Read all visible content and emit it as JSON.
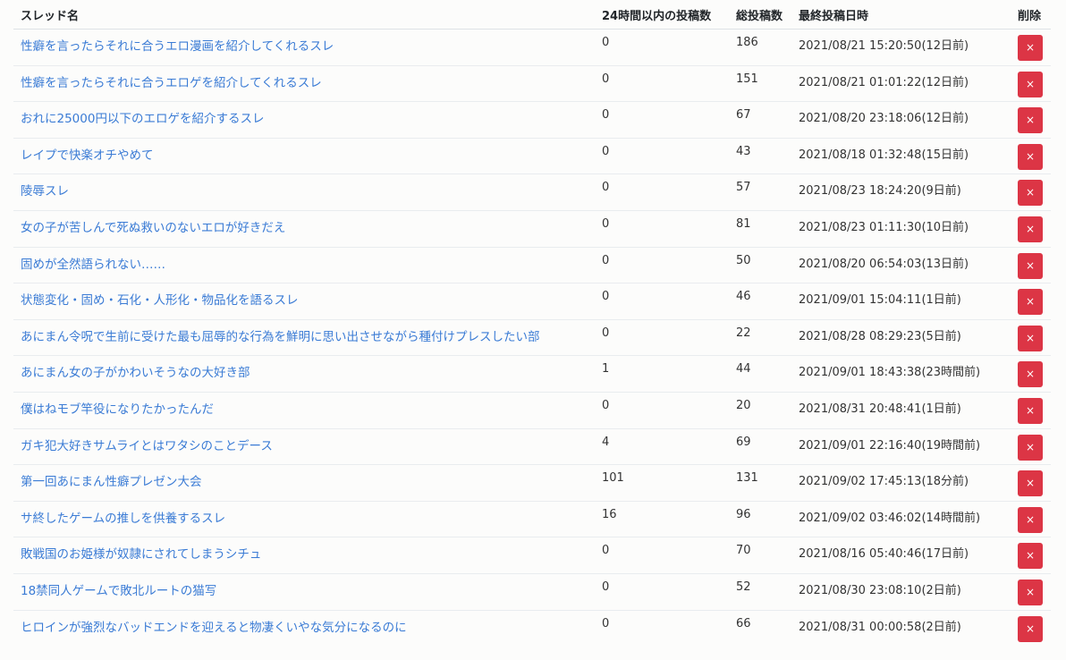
{
  "table": {
    "headers": {
      "title": "スレッド名",
      "posts_24h": "24時間以内の投稿数",
      "total_posts": "総投稿数",
      "last_post": "最終投稿日時",
      "delete": "削除"
    },
    "delete_label": "×",
    "rows": [
      {
        "title": "性癖を言ったらそれに合うエロ漫画を紹介してくれるスレ",
        "posts_24h": "0",
        "total": "186",
        "last": "2021/08/21 15:20:50(12日前)"
      },
      {
        "title": "性癖を言ったらそれに合うエロゲを紹介してくれるスレ",
        "posts_24h": "0",
        "total": "151",
        "last": "2021/08/21 01:01:22(12日前)"
      },
      {
        "title": "おれに25000円以下のエロゲを紹介するスレ",
        "posts_24h": "0",
        "total": "67",
        "last": "2021/08/20 23:18:06(12日前)"
      },
      {
        "title": "レイプで快楽オチやめて",
        "posts_24h": "0",
        "total": "43",
        "last": "2021/08/18 01:32:48(15日前)"
      },
      {
        "title": "陵辱スレ",
        "posts_24h": "0",
        "total": "57",
        "last": "2021/08/23 18:24:20(9日前)"
      },
      {
        "title": "女の子が苦しんで死ぬ救いのないエロが好きだえ",
        "posts_24h": "0",
        "total": "81",
        "last": "2021/08/23 01:11:30(10日前)"
      },
      {
        "title": "固めが全然語られない……",
        "posts_24h": "0",
        "total": "50",
        "last": "2021/08/20 06:54:03(13日前)"
      },
      {
        "title": "状態変化・固め・石化・人形化・物品化を語るスレ",
        "posts_24h": "0",
        "total": "46",
        "last": "2021/09/01 15:04:11(1日前)"
      },
      {
        "title": "あにまん令呪で生前に受けた最も屈辱的な行為を鮮明に思い出させながら種付けプレスしたい部",
        "posts_24h": "0",
        "total": "22",
        "last": "2021/08/28 08:29:23(5日前)"
      },
      {
        "title": "あにまん女の子がかわいそうなの大好き部",
        "posts_24h": "1",
        "total": "44",
        "last": "2021/09/01 18:43:38(23時間前)"
      },
      {
        "title": "僕はねモブ竿役になりたかったんだ",
        "posts_24h": "0",
        "total": "20",
        "last": "2021/08/31 20:48:41(1日前)"
      },
      {
        "title": "ガキ犯大好きサムライとはワタシのことデース",
        "posts_24h": "4",
        "total": "69",
        "last": "2021/09/01 22:16:40(19時間前)"
      },
      {
        "title": "第一回あにまん性癖プレゼン大会",
        "posts_24h": "101",
        "total": "131",
        "last": "2021/09/02 17:45:13(18分前)"
      },
      {
        "title": "サ終したゲームの推しを供養するスレ",
        "posts_24h": "16",
        "total": "96",
        "last": "2021/09/02 03:46:02(14時間前)"
      },
      {
        "title": "敗戦国のお姫様が奴隷にされてしまうシチュ",
        "posts_24h": "0",
        "total": "70",
        "last": "2021/08/16 05:40:46(17日前)"
      },
      {
        "title": "18禁同人ゲームで敗北ルートの猫写",
        "posts_24h": "0",
        "total": "52",
        "last": "2021/08/30 23:08:10(2日前)"
      },
      {
        "title": "ヒロインが強烈なバッドエンドを迎えると物凄くいやな気分になるのに",
        "posts_24h": "0",
        "total": "66",
        "last": "2021/08/31 00:00:58(2日前)"
      }
    ]
  }
}
